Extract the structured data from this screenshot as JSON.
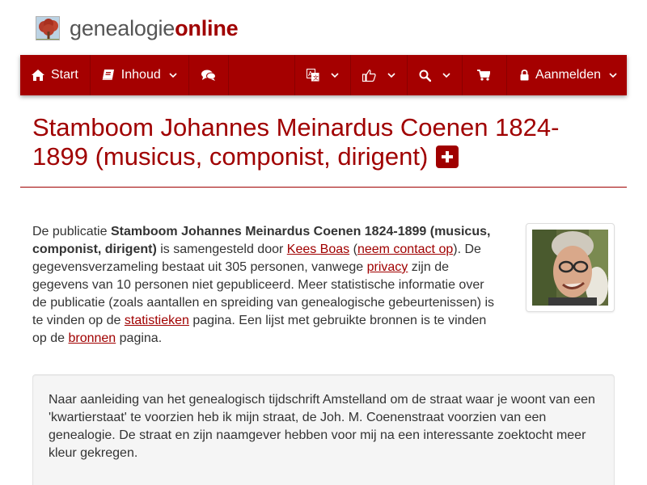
{
  "brand": {
    "name_part1": "genealogie",
    "name_part2": "online"
  },
  "nav": {
    "start": "Start",
    "inhoud": "Inhoud",
    "login": "Aanmelden"
  },
  "icons": {
    "home": "home-icon",
    "book": "book-icon",
    "comments": "comments-icon",
    "translate": "language-icon",
    "thumbs": "thumbs-up-icon",
    "search": "search-icon",
    "cart": "shopping-cart-icon",
    "lock": "lock-icon",
    "plus": "plus-square-icon"
  },
  "colors": {
    "accent": "#a50000",
    "link": "#a00000",
    "text": "#333333"
  },
  "page": {
    "title": "Stamboom Johannes Meinardus Coenen 1824-1899 (musicus, componist, dirigent)"
  },
  "intro": {
    "t1": "De publicatie ",
    "pub_name": "Stamboom Johannes Meinardus Coenen 1824-1899 (musicus, componist, dirigent)",
    "t2": " is samengesteld door ",
    "author_link": "Kees Boas",
    "t3": " (",
    "contact_link": "neem contact op",
    "t4": "). De gegevensverzameling bestaat uit 305 personen, vanwege ",
    "privacy_link": "privacy",
    "t5": " zijn de gegevens van 10 personen niet gepubliceerd. Meer statistische informatie over de publicatie (zoals aantallen en spreiding van genealogische gebeurtenissen) is te vinden op de ",
    "stats_link": "statistieken",
    "t6": " pagina. Een lijst met gebruikte bronnen is te vinden op de ",
    "sources_link": "bronnen",
    "t7": " pagina."
  },
  "description": "Naar aanleiding van het genealogisch tijdschrift Amstelland om de straat waar je woont van een 'kwartierstaat' te voorzien heb ik mijn straat, de Joh. M. Coenenstraat voorzien van een genealogie. De straat en zijn naamgever hebben voor mij na een interessante zoektocht meer kleur gekregen."
}
